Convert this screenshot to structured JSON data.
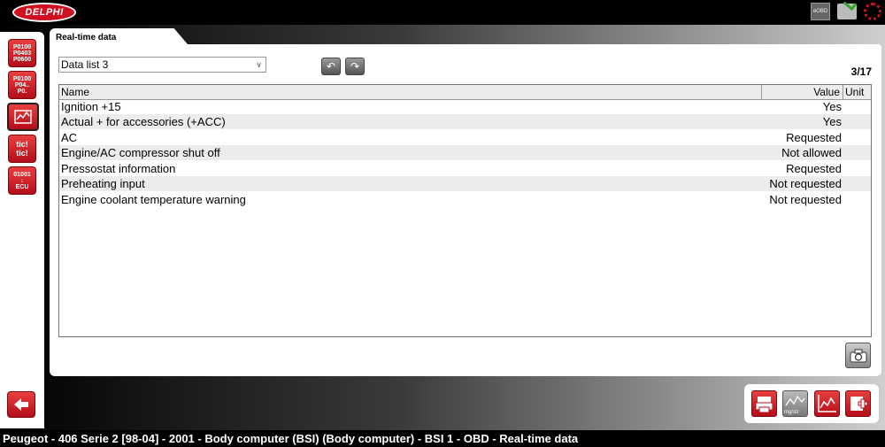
{
  "brand": {
    "logo_text": "DELPHI",
    "accent_color": "#d01020"
  },
  "top_icons": {
    "eobd_label": "eOBD"
  },
  "sidebar": {
    "items": [
      {
        "icon": "fault-codes-icon",
        "lines": [
          "P0100",
          "P0403",
          "P0600"
        ]
      },
      {
        "icon": "clear-codes-icon",
        "lines": [
          "P0100",
          "P04..",
          "P0."
        ]
      },
      {
        "icon": "realtime-data-icon",
        "lines": []
      },
      {
        "icon": "actuator-test-icon",
        "lines": [
          "tic!",
          "tic!"
        ]
      },
      {
        "icon": "ecu-info-icon",
        "lines": [
          "01001",
          "ECU"
        ]
      }
    ]
  },
  "tab": {
    "label": "Real-time data"
  },
  "data_list": {
    "selected": "Data list 3"
  },
  "page_count": "3/17",
  "table": {
    "columns": {
      "name": "Name",
      "value": "Value",
      "unit": "Unit"
    },
    "rows": [
      {
        "name": "Ignition +15",
        "value": "Yes",
        "unit": ""
      },
      {
        "name": "Actual + for accessories (+ACC)",
        "value": "Yes",
        "unit": ""
      },
      {
        "name": "AC",
        "value": "Requested",
        "unit": ""
      },
      {
        "name": "Engine/AC compressor shut off",
        "value": "Not allowed",
        "unit": ""
      },
      {
        "name": "Pressostat information",
        "value": "Requested",
        "unit": ""
      },
      {
        "name": "Preheating input",
        "value": "Not requested",
        "unit": ""
      },
      {
        "name": "Engine coolant temperature warning",
        "value": "Not requested",
        "unit": ""
      }
    ]
  },
  "tools": {
    "unit_label": "mg/str"
  },
  "status_bar": "Peugeot - 406 Serie 2 [98-04] - 2001 - Body computer (BSI) (Body computer) - BSI 1 - OBD - Real-time data"
}
